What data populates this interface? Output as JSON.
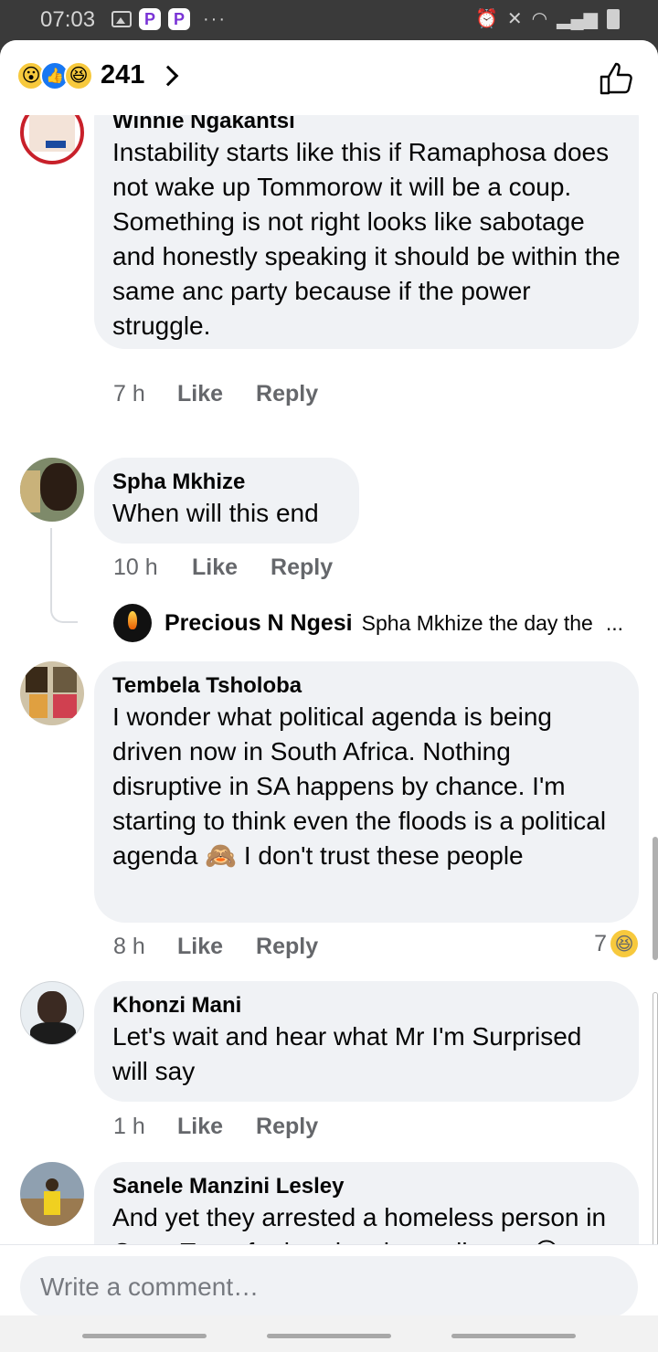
{
  "status_bar": {
    "time": "07:03",
    "app_badges": [
      "P",
      "P"
    ],
    "more": "···"
  },
  "header": {
    "reaction_count": "241",
    "reactions": [
      "wow",
      "like",
      "haha"
    ]
  },
  "comments": [
    {
      "author": "Winnie Ngakantsi",
      "text": "Instability starts like this if Ramaphosa does not wake up Tommorow it will be a coup. Something is not right looks like sabotage and honestly speaking it should be within the same anc party because if the power struggle.",
      "time": "7 h",
      "like": "Like",
      "reply": "Reply"
    },
    {
      "author": "Spha Mkhize",
      "text": "When will this end",
      "time": "10 h",
      "like": "Like",
      "reply": "Reply",
      "reply_preview": {
        "author": "Precious N Ngesi",
        "snippet": "Spha Mkhize the day the",
        "ellipsis": "..."
      }
    },
    {
      "author": "Tembela Tsholoba",
      "text": "I wonder what political agenda is being driven now in South Africa. Nothing disruptive in SA happens by chance. I'm starting to think even the floods is a political agenda 🙈 I don't trust these people",
      "time": "8 h",
      "like": "Like",
      "reply": "Reply",
      "reaction_count": "7"
    },
    {
      "author": "Khonzi Mani",
      "text": "Let's wait and hear what Mr I'm Surprised will say",
      "time": "1 h",
      "like": "Like",
      "reply": "Reply"
    },
    {
      "author": "Sanele Manzini Lesley",
      "text": "And yet they arrested a homeless person in Cape Town for burning the parliment 😂",
      "time": "",
      "like": "",
      "reply": ""
    }
  ],
  "composer": {
    "placeholder": "Write a comment…"
  }
}
